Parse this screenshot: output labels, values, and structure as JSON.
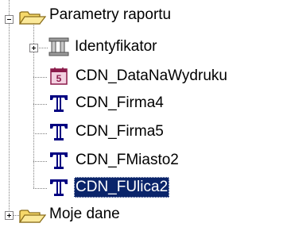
{
  "tree": {
    "root": {
      "label": "Parametry raportu",
      "icon": "folder-open-icon",
      "expanded": true,
      "children": [
        {
          "label": "Identyfikator",
          "icon": "key-column-icon",
          "collapsed": true
        },
        {
          "label": "CDN_DataNaWydruku",
          "icon": "calendar-icon"
        },
        {
          "label": "CDN_Firma4",
          "icon": "text-type-icon"
        },
        {
          "label": "CDN_Firma5",
          "icon": "text-type-icon"
        },
        {
          "label": "CDN_FMiasto2",
          "icon": "text-type-icon"
        },
        {
          "label": "CDN_FUlica2",
          "icon": "text-type-icon",
          "selected": true
        }
      ]
    },
    "sibling": {
      "label": "Moje dane",
      "icon": "folder-icon",
      "collapsed": true
    },
    "colors": {
      "selection_bg": "#0a246a",
      "selection_fg": "#ffffff",
      "text_icon": "#000080",
      "calendar": "#8b1a4a",
      "folder": "#f6d86a",
      "dotted_line": "#808080"
    }
  }
}
